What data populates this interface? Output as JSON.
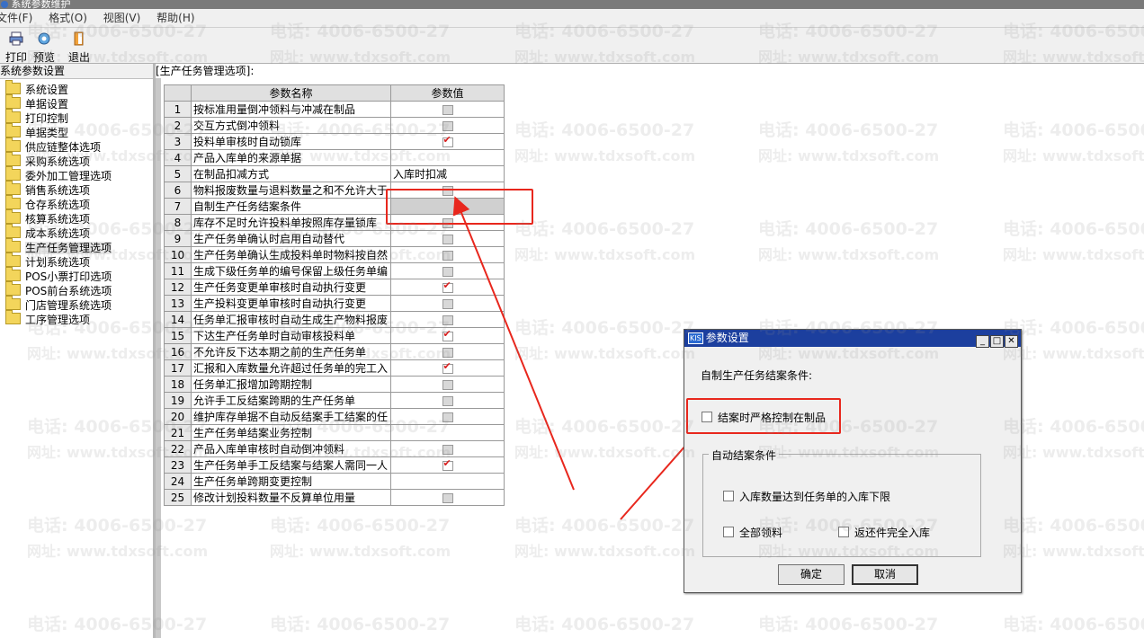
{
  "window": {
    "title": "系统参数维护"
  },
  "menu": [
    "文件(F)",
    "格式(O)",
    "视图(V)",
    "帮助(H)"
  ],
  "toolbar": {
    "print": "打印",
    "preview": "预览",
    "exit": "退出"
  },
  "sidebar": {
    "header": "系统参数设置",
    "items": [
      "系统设置",
      "单据设置",
      "打印控制",
      "单据类型",
      "供应链整体选项",
      "采购系统选项",
      "委外加工管理选项",
      "销售系统选项",
      "仓存系统选项",
      "核算系统选项",
      "成本系统选项",
      "生产任务管理选项",
      "计划系统选项",
      "POS小票打印选项",
      "POS前台系统选项",
      "门店管理系统选项",
      "工序管理选项"
    ],
    "selected_index": 11
  },
  "main": {
    "header": "[生产任务管理选项]:",
    "col_name": "参数名称",
    "col_value": "参数值",
    "rows": [
      {
        "n": "1",
        "name": "按标准用量倒冲领料与冲减在制品",
        "val": "cb"
      },
      {
        "n": "2",
        "name": "交互方式倒冲领料",
        "val": "cb"
      },
      {
        "n": "3",
        "name": "投料单审核时自动锁库",
        "val": "cb-on"
      },
      {
        "n": "4",
        "name": "产品入库单的来源单据",
        "val": ""
      },
      {
        "n": "5",
        "name": "在制品扣减方式",
        "val": "入库时扣减"
      },
      {
        "n": "6",
        "name": "物料报废数量与退料数量之和不允许大于",
        "val": "cb"
      },
      {
        "n": "7",
        "name": "自制生产任务结案条件",
        "val": "sel"
      },
      {
        "n": "8",
        "name": "库存不足时允许投料单按照库存量锁库",
        "val": "cb"
      },
      {
        "n": "9",
        "name": "生产任务单确认时启用自动替代",
        "val": "cb"
      },
      {
        "n": "10",
        "name": "生产任务单确认生成投料单时物料按自然",
        "val": "cb"
      },
      {
        "n": "11",
        "name": "生成下级任务单的编号保留上级任务单编",
        "val": "cb"
      },
      {
        "n": "12",
        "name": "生产任务变更单审核时自动执行变更",
        "val": "cb-on"
      },
      {
        "n": "13",
        "name": "生产投料变更单审核时自动执行变更",
        "val": "cb"
      },
      {
        "n": "14",
        "name": "任务单汇报审核时自动生成生产物料报废",
        "val": "cb"
      },
      {
        "n": "15",
        "name": "下达生产任务单时自动审核投料单",
        "val": "cb-on"
      },
      {
        "n": "16",
        "name": "不允许反下达本期之前的生产任务单",
        "val": "cb"
      },
      {
        "n": "17",
        "name": "汇报和入库数量允许超过任务单的完工入",
        "val": "cb-on"
      },
      {
        "n": "18",
        "name": "任务单汇报增加跨期控制",
        "val": "cb"
      },
      {
        "n": "19",
        "name": "允许手工反结案跨期的生产任务单",
        "val": "cb"
      },
      {
        "n": "20",
        "name": "维护库存单据不自动反结案手工结案的任",
        "val": "cb"
      },
      {
        "n": "21",
        "name": "生产任务单结案业务控制",
        "val": ""
      },
      {
        "n": "22",
        "name": "产品入库单审核时自动倒冲领料",
        "val": "cb"
      },
      {
        "n": "23",
        "name": "生产任务单手工反结案与结案人需同一人",
        "val": "cb-on"
      },
      {
        "n": "24",
        "name": "生产任务单跨期变更控制",
        "val": ""
      },
      {
        "n": "25",
        "name": "修改计划投料数量不反算单位用量",
        "val": "cb"
      }
    ]
  },
  "dialog": {
    "title": "参数设置",
    "badge": "KIS",
    "heading": "自制生产任务结案条件:",
    "strict_wip": "结案时严格控制在制品",
    "group_title": "自动结案条件",
    "opt_inbound": "入库数量达到任务单的入库下限",
    "opt_all_issue": "全部领料",
    "opt_return": "返还件完全入库",
    "ok": "确定",
    "cancel": "取消"
  },
  "watermark": {
    "phone": "电话: 4006-6500-27",
    "site": "网址: www.tdxsoft.com"
  },
  "colors": {
    "accent_red": "#e8271d",
    "check_red": "#d81e1e",
    "dialog_title": "#1c3f9e"
  }
}
